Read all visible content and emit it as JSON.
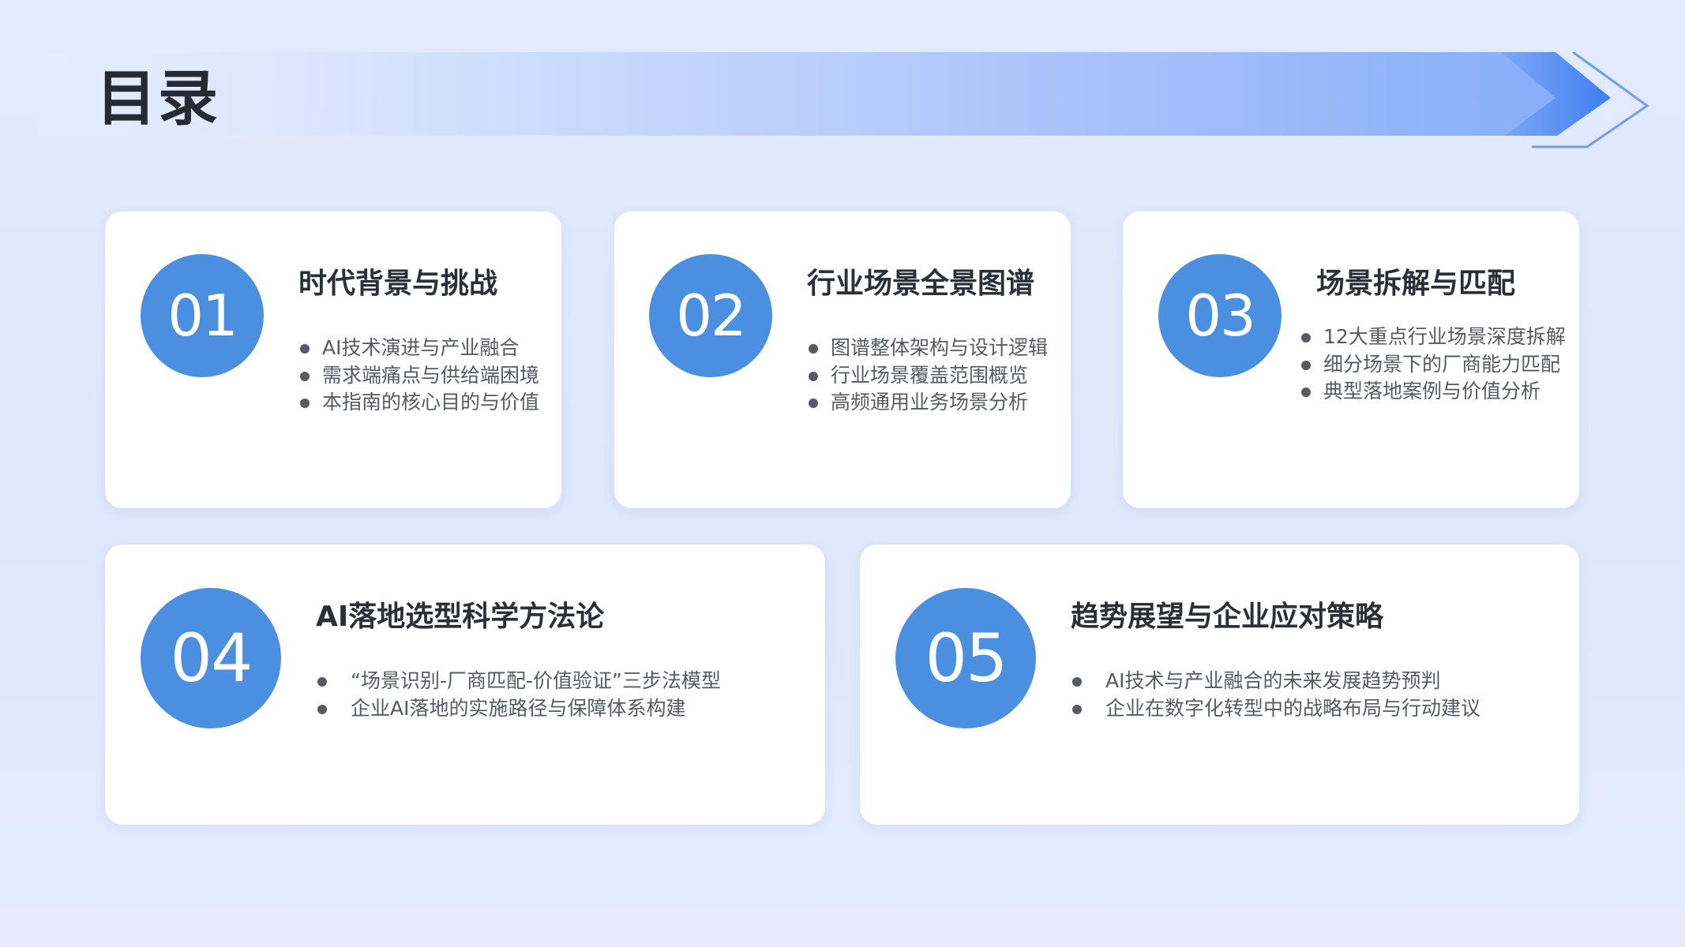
{
  "page": {
    "title": "目录"
  },
  "colors": {
    "accent": "#4a8fe0",
    "banner_start": "#e6eefe",
    "banner_end": "#7ea8f7",
    "card_bg": "#ffffff",
    "title_text": "#262a33",
    "body_text": "#555a63"
  },
  "sections": [
    {
      "number": "01",
      "title": "时代背景与挑战",
      "items": [
        "AI技术演进与产业融合",
        "需求端痛点与供给端困境",
        "本指南的核心目的与价值"
      ]
    },
    {
      "number": "02",
      "title": "行业场景全景图谱",
      "items": [
        "图谱整体架构与设计逻辑",
        "行业场景覆盖范围概览",
        "高频通用业务场景分析"
      ]
    },
    {
      "number": "03",
      "title": "场景拆解与匹配",
      "items": [
        "12大重点行业场景深度拆解",
        "细分场景下的厂商能力匹配",
        "典型落地案例与价值分析"
      ]
    },
    {
      "number": "04",
      "title": "AI落地选型科学方法论",
      "items": [
        "“场景识别-厂商匹配-价值验证”三步法模型",
        "企业AI落地的实施路径与保障体系构建"
      ]
    },
    {
      "number": "05",
      "title": "趋势展望与企业应对策略",
      "items": [
        "AI技术与产业融合的未来发展趋势预判",
        "企业在数字化转型中的战略布局与行动建议"
      ]
    }
  ]
}
